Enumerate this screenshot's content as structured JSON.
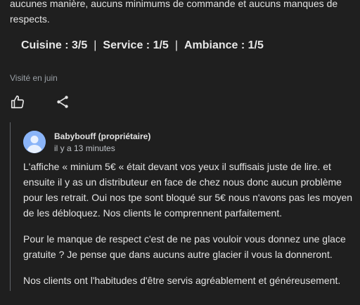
{
  "review": {
    "text_tail": "aucunes manière, aucuns minimums de commande et aucuns manques de respects.",
    "ratings": [
      {
        "label": "Cuisine : 3/5"
      },
      {
        "label": "Service : 1/5"
      },
      {
        "label": "Ambiance : 1/5"
      }
    ],
    "separator": "|",
    "visited": "Visité en juin",
    "like_icon": "thumbs-up-icon",
    "share_icon": "share-icon"
  },
  "owner_reply": {
    "owner_name": "Babybouff",
    "owner_role": "(propriétaire)",
    "time": "il y a 13 minutes",
    "paragraphs": [
      "L'affiche « minium 5€ «  était devant vos yeux il suffisais juste de lire. et ensuite il y as un distributeur en face de chez nous donc aucun problème pour les retrait. Oui nos tpe sont bloqué sur 5€ nous n'avons pas les moyen de les débloquez. Nos clients le comprennent parfaitement.",
      "Pour le manque de respect c'est de ne pas vouloir vous donnez une glace gratuite ? Je pense que dans aucuns autre glacier il vous la donneront.",
      "Nos clients ont l'habitudes d'être servis agréablement et généreusement."
    ],
    "avatar_color": "#8ab4f8"
  }
}
